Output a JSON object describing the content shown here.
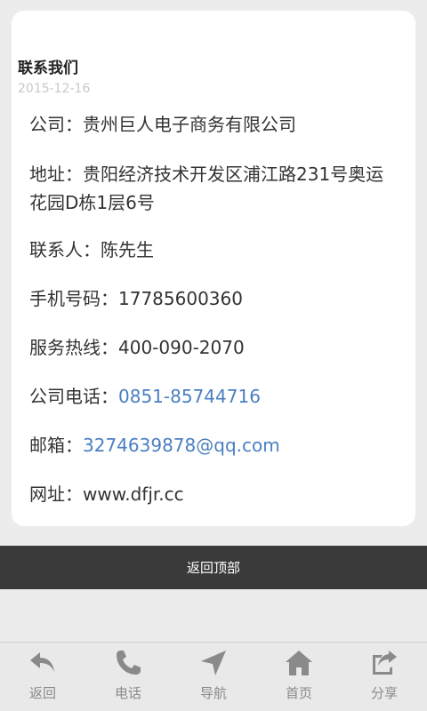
{
  "article": {
    "title": "联系我们",
    "date": "2015-12-16",
    "company": "公司：贵州巨人电子商务有限公司",
    "address": "地址：贵阳经济技术开发区浦江路231号奥运花园D栋1层6号",
    "contact": "联系人：陈先生",
    "mobile": "手机号码：17785600360",
    "hotline": "服务热线：400-090-2070",
    "phone_label": "公司电话：",
    "phone_value": "0851-85744716",
    "email_label": "邮箱：",
    "email_value": "3274639878@qq.com",
    "website": "网址：www.dfjr.cc"
  },
  "back_to_top": "返回顶部",
  "tabbar": {
    "items": [
      {
        "label": "返回",
        "icon": "back-arrow-icon"
      },
      {
        "label": "电话",
        "icon": "phone-icon"
      },
      {
        "label": "导航",
        "icon": "navigation-icon"
      },
      {
        "label": "首页",
        "icon": "home-icon"
      },
      {
        "label": "分享",
        "icon": "share-icon"
      }
    ]
  },
  "colors": {
    "link": "#4a7fc1",
    "bar": "#3a3a3a",
    "icon": "#8a8a8a"
  }
}
